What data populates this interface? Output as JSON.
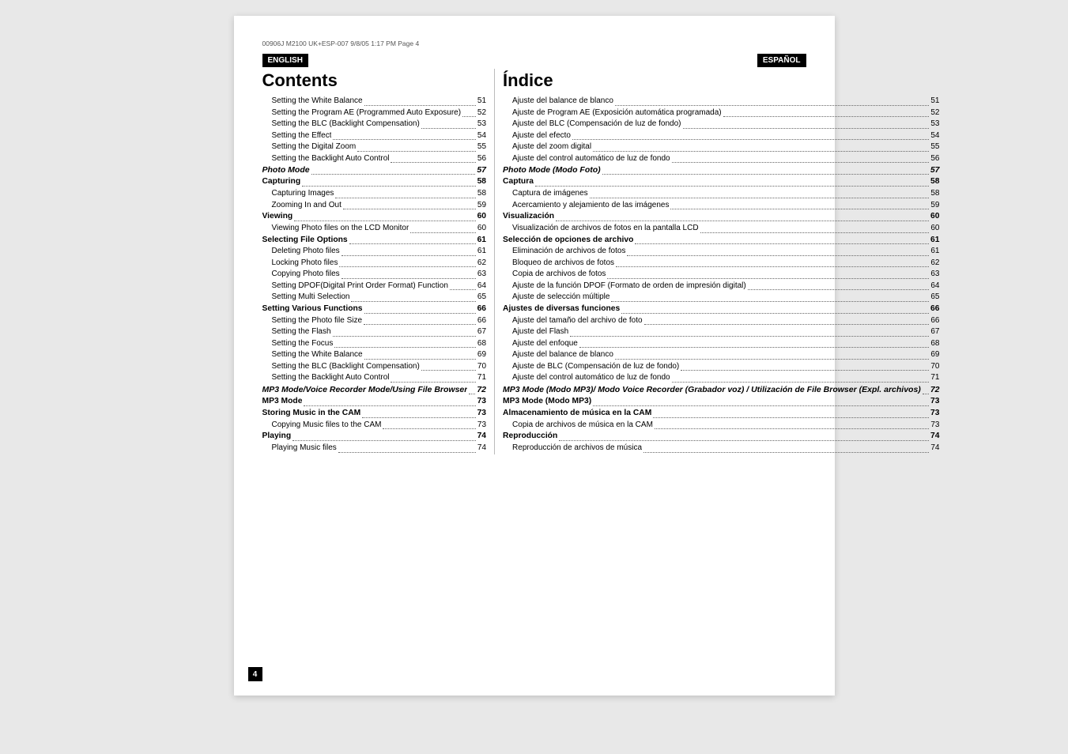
{
  "header_note": "00906J M2100 UK+ESP-007  9/8/05 1:17 PM  Page 4",
  "english_label": "ENGLISH",
  "espanol_label": "ESPAÑOL",
  "left_title": "Contents",
  "right_title": "Índice",
  "page_number": "4",
  "left_items": [
    {
      "indent": 1,
      "title": "Setting the White Balance",
      "page": "51"
    },
    {
      "indent": 1,
      "title": "Setting the Program AE (Programmed Auto Exposure)",
      "page": "52"
    },
    {
      "indent": 1,
      "title": "Setting the BLC (Backlight Compensation)",
      "page": "53"
    },
    {
      "indent": 1,
      "title": "Setting the Effect",
      "page": "54"
    },
    {
      "indent": 1,
      "title": "Setting the Digital Zoom",
      "page": "55"
    },
    {
      "indent": 1,
      "title": "Setting the Backlight Auto Control",
      "page": "56"
    },
    {
      "indent": 0,
      "title": "Photo Mode",
      "page": "57",
      "italic": true
    },
    {
      "indent": 0,
      "title": "Capturing",
      "page": "58",
      "bold": true
    },
    {
      "indent": 1,
      "title": "Capturing Images",
      "page": "58"
    },
    {
      "indent": 1,
      "title": "Zooming In and Out",
      "page": "59"
    },
    {
      "indent": 0,
      "title": "Viewing",
      "page": "60",
      "bold": true
    },
    {
      "indent": 1,
      "title": "Viewing Photo files on the LCD Monitor",
      "page": "60"
    },
    {
      "indent": 0,
      "title": "Selecting File Options",
      "page": "61",
      "bold": true
    },
    {
      "indent": 1,
      "title": "Deleting Photo files",
      "page": "61"
    },
    {
      "indent": 1,
      "title": "Locking Photo files",
      "page": "62"
    },
    {
      "indent": 1,
      "title": "Copying Photo files",
      "page": "63"
    },
    {
      "indent": 1,
      "title": "Setting DPOF(Digital Print Order Format) Function",
      "page": "64"
    },
    {
      "indent": 1,
      "title": "Setting Multi Selection",
      "page": "65"
    },
    {
      "indent": 0,
      "title": "Setting Various Functions",
      "page": "66",
      "bold": true
    },
    {
      "indent": 1,
      "title": "Setting the Photo file Size",
      "page": "66"
    },
    {
      "indent": 1,
      "title": "Setting the Flash",
      "page": "67"
    },
    {
      "indent": 1,
      "title": "Setting the Focus",
      "page": "68"
    },
    {
      "indent": 1,
      "title": "Setting the White Balance",
      "page": "69"
    },
    {
      "indent": 1,
      "title": "Setting the BLC (Backlight Compensation)",
      "page": "70"
    },
    {
      "indent": 1,
      "title": "Setting the Backlight Auto Control",
      "page": "71"
    },
    {
      "indent": 0,
      "title": "MP3 Mode/Voice Recorder Mode/Using File Browser",
      "page": "72",
      "italic": true
    },
    {
      "indent": 0,
      "title": "MP3 Mode",
      "page": "73",
      "bold": true
    },
    {
      "indent": 0,
      "title": "Storing Music in the CAM",
      "page": "73",
      "bold": true
    },
    {
      "indent": 1,
      "title": "Copying Music files to the CAM",
      "page": "73"
    },
    {
      "indent": 0,
      "title": "Playing",
      "page": "74",
      "bold": true
    },
    {
      "indent": 1,
      "title": "Playing Music files",
      "page": "74"
    }
  ],
  "right_items": [
    {
      "indent": 1,
      "title": "Ajuste del balance de blanco",
      "page": "51"
    },
    {
      "indent": 1,
      "title": "Ajuste de Program AE (Exposición automática programada)",
      "page": "52"
    },
    {
      "indent": 1,
      "title": "Ajuste del BLC (Compensación de luz de fondo)",
      "page": "53"
    },
    {
      "indent": 1,
      "title": "Ajuste del efecto",
      "page": "54"
    },
    {
      "indent": 1,
      "title": "Ajuste del zoom digital",
      "page": "55"
    },
    {
      "indent": 1,
      "title": "Ajuste del control automático de luz de fondo",
      "page": "56"
    },
    {
      "indent": 0,
      "title": "Photo Mode (Modo Foto)",
      "page": "57",
      "italic": true
    },
    {
      "indent": 0,
      "title": "Captura",
      "page": "58",
      "bold": true
    },
    {
      "indent": 1,
      "title": "Captura de imágenes",
      "page": "58"
    },
    {
      "indent": 1,
      "title": "Acercamiento y alejamiento de las imágenes",
      "page": "59"
    },
    {
      "indent": 0,
      "title": "Visualización",
      "page": "60",
      "bold": true
    },
    {
      "indent": 1,
      "title": "Visualización de archivos de fotos en la pantalla LCD",
      "page": "60"
    },
    {
      "indent": 0,
      "title": "Selección de opciones de archivo",
      "page": "61",
      "bold": true
    },
    {
      "indent": 1,
      "title": "Eliminación de archivos de fotos",
      "page": "61"
    },
    {
      "indent": 1,
      "title": "Bloqueo de archivos de fotos",
      "page": "62"
    },
    {
      "indent": 1,
      "title": "Copia de archivos de fotos",
      "page": "63"
    },
    {
      "indent": 1,
      "title": "Ajuste de la función DPOF (Formato de orden de impresión digital)",
      "page": "64"
    },
    {
      "indent": 1,
      "title": "Ajuste de selección múltiple",
      "page": "65"
    },
    {
      "indent": 0,
      "title": "Ajustes de diversas funciones",
      "page": "66",
      "bold": true
    },
    {
      "indent": 1,
      "title": "Ajuste del tamaño del archivo de foto",
      "page": "66"
    },
    {
      "indent": 1,
      "title": "Ajuste del Flash",
      "page": "67"
    },
    {
      "indent": 1,
      "title": "Ajuste del enfoque",
      "page": "68"
    },
    {
      "indent": 1,
      "title": "Ajuste del balance de blanco",
      "page": "69"
    },
    {
      "indent": 1,
      "title": "Ajuste de BLC (Compensación de luz de fondo)",
      "page": "70"
    },
    {
      "indent": 1,
      "title": "Ajuste del control automático de luz de fondo",
      "page": "71"
    },
    {
      "indent": 0,
      "title": "MP3 Mode (Modo MP3)/ Modo Voice Recorder (Grabador voz) / Utilización de File Browser (Expl. archivos)",
      "page": "72",
      "italic": true
    },
    {
      "indent": 0,
      "title": "MP3 Mode (Modo MP3)",
      "page": "73",
      "bold": true
    },
    {
      "indent": 0,
      "title": "Almacenamiento de música en la CAM",
      "page": "73",
      "bold": true
    },
    {
      "indent": 1,
      "title": "Copia de archivos de música en la CAM",
      "page": "73"
    },
    {
      "indent": 0,
      "title": "Reproducción",
      "page": "74",
      "bold": true
    },
    {
      "indent": 1,
      "title": "Reproducción de archivos de música",
      "page": "74"
    }
  ]
}
